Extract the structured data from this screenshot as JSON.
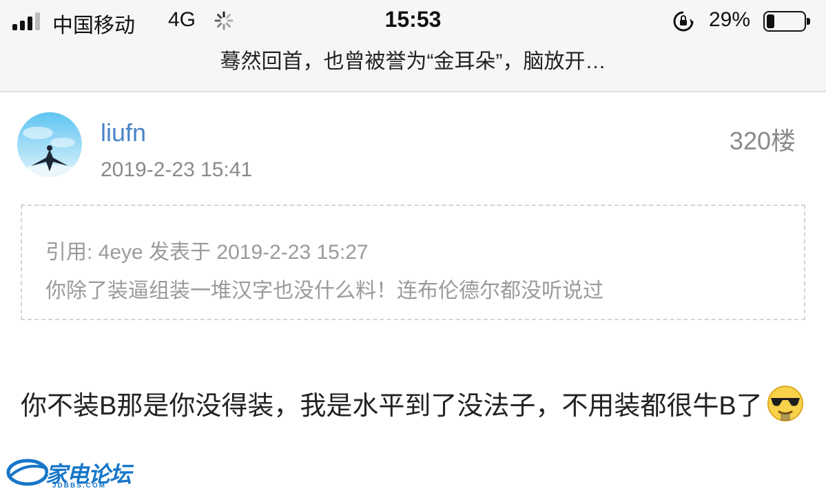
{
  "status_bar": {
    "carrier": "中国移动",
    "network": "4G",
    "time": "15:53",
    "battery_percent": "29%",
    "battery_level": 0.29
  },
  "nav": {
    "title": "蓦然回首，也曾被誉为“金耳朵”，脑放开…"
  },
  "post": {
    "username": "liufn",
    "time": "2019-2-23 15:41",
    "floor": "320楼",
    "quote": {
      "header": "引用: 4eye 发表于 2019-2-23 15:27",
      "text": "你除了装逼组装一堆汉字也没什么料！连布伦德尔都没听说过"
    },
    "content": "你不装B那是你没得装，我是水平到了没法子，不用装都很牛B了"
  },
  "watermark": {
    "text": "家电论坛",
    "sub": "JDBBS.COM"
  },
  "colors": {
    "username": "#4a84c7",
    "meta": "#8a8a8a",
    "quote_text": "#9a9a9a",
    "topbar_bg": "#f6f6f6",
    "watermark": "#1776c8"
  }
}
